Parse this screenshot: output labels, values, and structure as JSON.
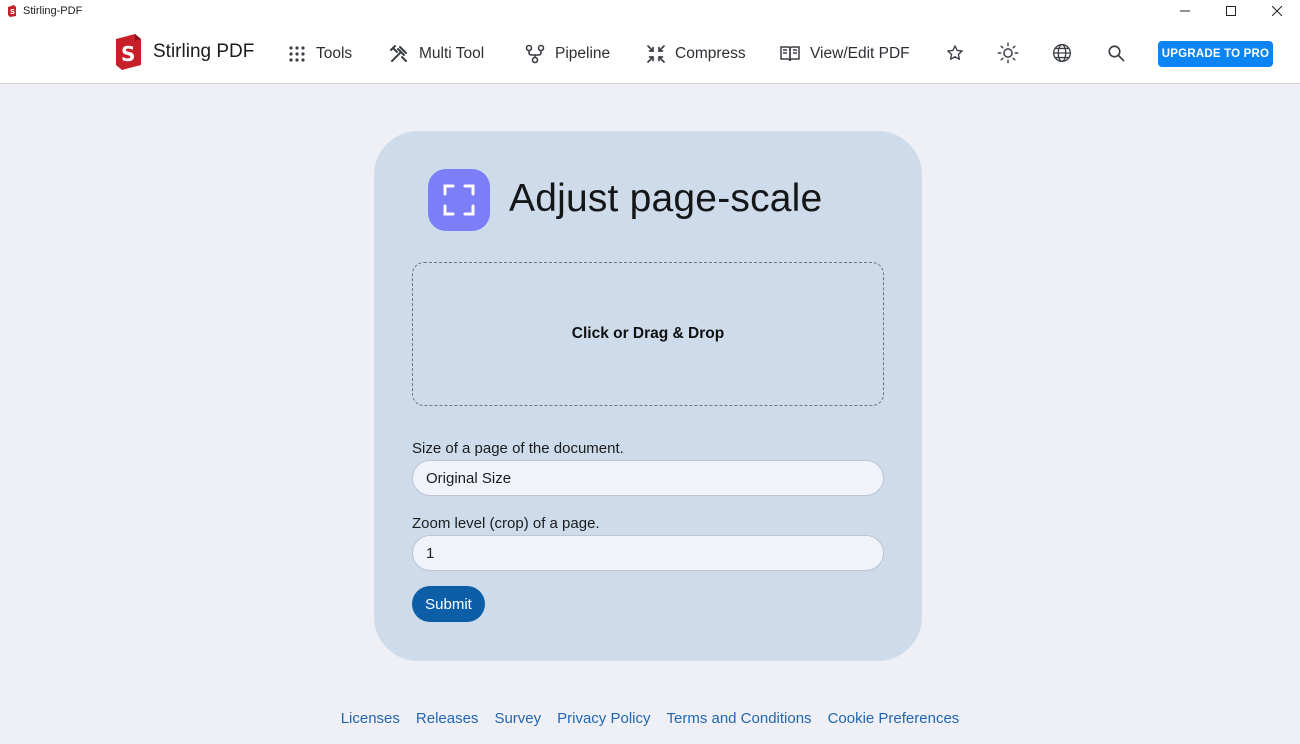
{
  "window": {
    "title": "Stirling-PDF",
    "controls": [
      "minimize-icon",
      "maximize-icon",
      "close-icon"
    ]
  },
  "navbar": {
    "brand": "Stirling PDF",
    "items": [
      {
        "label": "Tools",
        "icon": "grid-dots-icon"
      },
      {
        "label": "Multi Tool",
        "icon": "tools-icon"
      },
      {
        "label": "Pipeline",
        "icon": "pipeline-icon"
      },
      {
        "label": "Compress",
        "icon": "compress-arrows-icon"
      },
      {
        "label": "View/Edit PDF",
        "icon": "book-open-icon"
      }
    ],
    "icons": [
      "star-icon",
      "sun-icon",
      "globe-icon",
      "search-icon"
    ],
    "upgrade_label": "UPGRADE TO PRO",
    "colors": {
      "upgrade_bg": "#0d84f3"
    }
  },
  "card": {
    "title": "Adjust page-scale",
    "icon": "fullscreen-frame-icon",
    "dropzone_label": "Click or Drag & Drop",
    "page_size": {
      "label": "Size of a page of the document.",
      "value": "Original Size"
    },
    "zoom": {
      "label": "Zoom level (crop) of a page.",
      "value": "1"
    },
    "submit_label": "Submit",
    "colors": {
      "card_bg": "#cddbea",
      "icon_bg": "#7b7ef7",
      "submit_bg": "#0c5ea6"
    }
  },
  "footer": {
    "links": [
      "Licenses",
      "Releases",
      "Survey",
      "Privacy Policy",
      "Terms and Conditions",
      "Cookie Preferences"
    ],
    "color": "#2266b0"
  }
}
